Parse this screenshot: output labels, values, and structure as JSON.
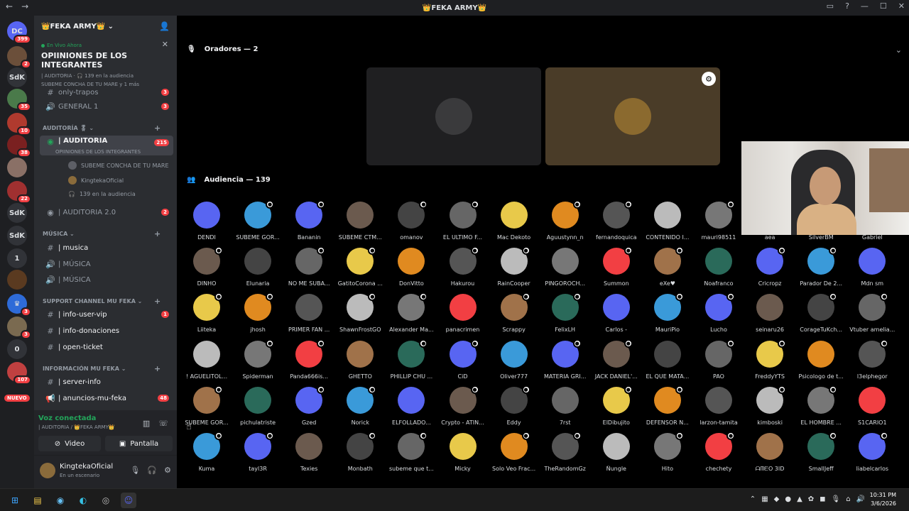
{
  "window": {
    "title": "👑FEKA ARMY👑",
    "back": "←",
    "forward": "→",
    "min": "—",
    "max": "☐",
    "close": "✕"
  },
  "guilds": [
    {
      "label": "DC",
      "badge": "399",
      "color": "#5865f2"
    },
    {
      "label": "",
      "badge": "2",
      "color": "#6b4f3a"
    },
    {
      "label": "SdK",
      "badge": "",
      "color": "#313338"
    },
    {
      "label": "",
      "badge": "35",
      "color": "#4a7a4a"
    },
    {
      "label": "",
      "badge": "10",
      "color": "#b03a2e"
    },
    {
      "label": "",
      "badge": "38",
      "color": "#7a2020"
    },
    {
      "label": "",
      "badge": "",
      "color": "#8a7066"
    },
    {
      "label": "",
      "badge": "22",
      "color": "#a03030"
    },
    {
      "label": "SdK",
      "badge": "",
      "color": "#313338"
    },
    {
      "label": "SdK",
      "badge": "",
      "color": "#313338"
    },
    {
      "label": "1",
      "badge": "",
      "color": "#313338"
    },
    {
      "label": "",
      "badge": "",
      "color": "#5a3a20"
    },
    {
      "label": "♛",
      "badge": "3",
      "color": "#2e6bd8"
    },
    {
      "label": "",
      "badge": "3",
      "color": "#7a6a50"
    },
    {
      "label": "0",
      "badge": "",
      "color": "#313338"
    },
    {
      "label": "",
      "badge": "107",
      "color": "#c04040"
    }
  ],
  "guild_new": "NUEVO",
  "server": {
    "name": "👑FEKA ARMY👑",
    "chevron": "⌄"
  },
  "stage": {
    "live": "En Vivo Ahora",
    "title": "OPIINIONES DE LOS INTEGRANTES",
    "meta": "| AUDITORIA · 🎧 139 en la audiencia",
    "meta2": "SUBEME CONCHA DE TU MARE y 1 más"
  },
  "channels": {
    "only_trapos": "only-trapos",
    "only_trapos_badge": "3",
    "general": "GENERAL 1",
    "general_badge": "3",
    "cat_auditoria": "AUDITORÍA 🎖",
    "auditoria": "| AUDITORIA",
    "auditoria_sub": "OPIINIONES DE LOS INTEGRANTES",
    "auditoria_badge": "215",
    "sub1": "SUBEME CONCHA DE TU MARE",
    "sub2": "KingtekaOficial",
    "sub3": "139 en la audiencia",
    "auditoria2": "| AUDITORIA 2.0",
    "auditoria2_badge": "2",
    "cat_musica": "MÚSICA",
    "musica": "| musica",
    "musica2": "| MÚSICA",
    "musica3": "| MÚSICA",
    "cat_support": "SUPPORT CHANNEL MU FEKA",
    "info_vip": "| info-user-vip",
    "info_vip_badge": "1",
    "info_don": "| info-donaciones",
    "open_ticket": "| open-ticket",
    "cat_info": "INFORMACIÓN MU FEKA",
    "server_info": "| server-info",
    "anuncios": "| anuncios-mu-feka",
    "anuncios_badge": "48"
  },
  "voice": {
    "status": "Voz conectada",
    "location": "| AUDITORIA / 👑FEKA ARMY👑",
    "video": "Video",
    "screen": "Pantalla"
  },
  "user": {
    "name": "KingtekaOficial",
    "status": "En un escenario"
  },
  "speakers_header": "Oradores — 2",
  "audience_header": "Audiencia — 139",
  "audience": [
    "DENDI",
    "SUBEME GOR...",
    "Bananin",
    "SÚBEME CTM...",
    "omanov",
    "EL ULTIMO F...",
    "Mac Dekoto",
    "Aguustynn_n",
    "fernandoquica",
    "CONTENIDO I...",
    "mauri98511",
    "aea",
    "SilverBM",
    "Gabriel",
    "DINHO",
    "Elunaria",
    "NO ME SUBA...",
    "GatitoCorona ...",
    "DonVitto",
    "Hakurou",
    "RainCooper",
    "PINGOROCH...",
    "Summon",
    "eXe♥",
    "Noafranco",
    "Cricropz",
    "Parador De 2...",
    "Mdn sm",
    "Liiteka",
    "jhosh",
    "PRIMER FAN ...",
    "ShawnFrostGO",
    "Alexander Ma...",
    "panacrimen",
    "Scrappy",
    "FelixLH",
    "Carlos -",
    "MauriPio",
    "Lucho",
    "seinaru26",
    "CorageTuKch...",
    "Vtuber amelia...",
    "! AGUELITOL...",
    "Spiderman",
    "Panda666is...",
    "GHETTO",
    "PHILLIP CHU ...",
    "CiD",
    "Oliver777",
    "MATERIA GRI...",
    "JACK DANIEL'...",
    "EL QUE MATA...",
    "PAO",
    "FreddyYTS",
    "Psicologo de t...",
    "l3elphegor",
    "SUBEME GOR...",
    "pichulatriste",
    "Gzed",
    "Norick",
    "ELFOLLADO...",
    "Crypto - ATIN...",
    "Eddy",
    "7rst",
    "ElDibujito",
    "DEFENSOR N...",
    "larzon-tamita",
    "kimboski",
    "EL HOMBRE ...",
    "S1CARIO1",
    "Kuma",
    "tayl3R",
    "Texies",
    "Monbath",
    "subeme que t...",
    "Micky",
    "Solo Veo Frac...",
    "TheRandomGz",
    "Ñungle",
    "Hito",
    "chechety",
    "ᗩᗰᗴO 3ID",
    "SmallJeff",
    "liabelcarlos"
  ],
  "taskbar": {
    "time": "10:31 PM",
    "date": "3/6/2026"
  }
}
